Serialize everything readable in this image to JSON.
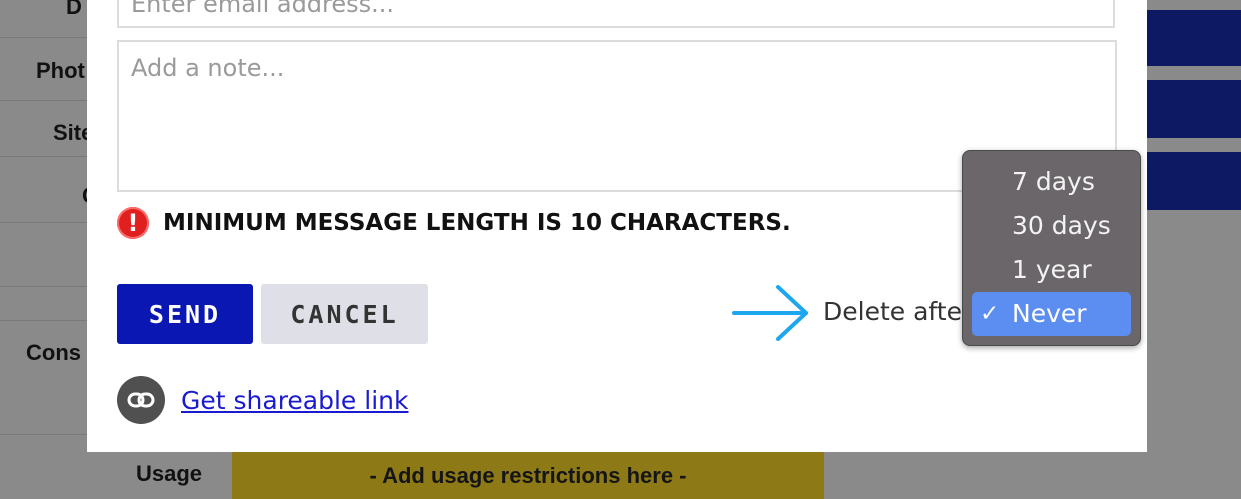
{
  "background": {
    "labels": [
      "D",
      "Phot",
      "Site",
      "C",
      "Cons"
    ],
    "usage_label": "Usage",
    "usage_value": "- Add usage restrictions here -"
  },
  "modal": {
    "email_placeholder": "Enter email address...",
    "note_placeholder": "Add a note...",
    "error_message": "MINIMUM MESSAGE LENGTH IS 10 CHARACTERS.",
    "error_icon": "!",
    "send_label": "SEND",
    "cancel_label": "CANCEL",
    "delete_after_label": "Delete after",
    "share_link_label": "Get shareable link"
  },
  "dropdown": {
    "options": [
      "7 days",
      "30 days",
      "1 year",
      "Never"
    ],
    "selected": "Never",
    "check": "✓"
  },
  "colors": {
    "send": "#0a17b3",
    "error": "#e0201f",
    "link": "#1a1ad0",
    "arrow": "#1ea7ef",
    "selected_option": "#5b8ef0"
  }
}
